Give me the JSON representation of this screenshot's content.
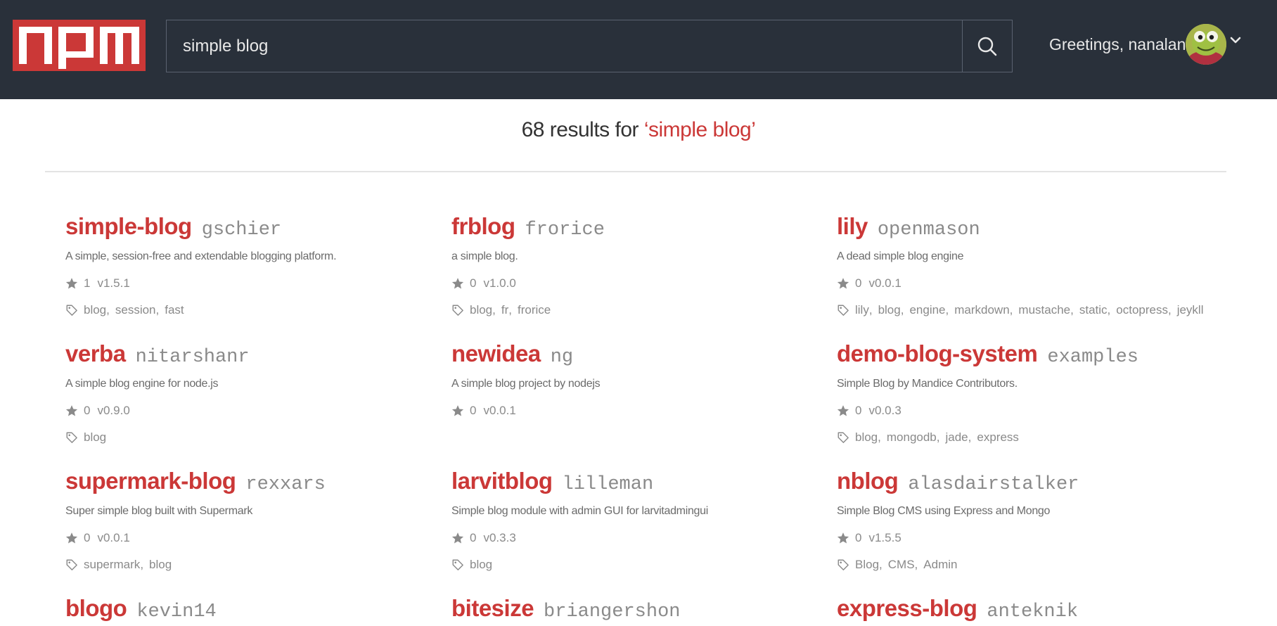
{
  "header": {
    "logo_text": "npm",
    "search_value": "simple blog",
    "search_icon": "search-icon",
    "greeting": "Greetings, nanalan",
    "avatar_icon": "avatar",
    "menu_icon": "chevron-down-icon"
  },
  "results": {
    "count": "68",
    "middle": " results for ",
    "query": "‘simple blog’"
  },
  "colors": {
    "header_bg": "#29303a",
    "brand_red": "#cb3837"
  },
  "packages": [
    {
      "name": "simple-blog",
      "author": "gschier",
      "description": "A simple, session-free and extendable blogging platform.",
      "stars": "1",
      "version": "v1.5.1",
      "tags": [
        "blog",
        "session",
        "fast"
      ]
    },
    {
      "name": "frblog",
      "author": "frorice",
      "description": "a simple blog.",
      "stars": "0",
      "version": "v1.0.0",
      "tags": [
        "blog",
        "fr",
        "frorice"
      ]
    },
    {
      "name": "lily",
      "author": "openmason",
      "description": "A dead simple blog engine",
      "stars": "0",
      "version": "v0.0.1",
      "tags": [
        "lily",
        "blog",
        "engine",
        "markdown",
        "mustache",
        "static",
        "octopress",
        "jeykll"
      ]
    },
    {
      "name": "verba",
      "author": "nitarshanr",
      "description": "A simple blog engine for node.js",
      "stars": "0",
      "version": "v0.9.0",
      "tags": [
        "blog"
      ]
    },
    {
      "name": "newidea",
      "author": "ng",
      "description": "A simple blog project by nodejs",
      "stars": "0",
      "version": "v0.0.1",
      "tags": []
    },
    {
      "name": "demo-blog-system",
      "author": "examples",
      "description": "Simple Blog by Mandice Contributors.",
      "stars": "0",
      "version": "v0.0.3",
      "tags": [
        "blog",
        "mongodb",
        "jade",
        "express"
      ]
    },
    {
      "name": "supermark-blog",
      "author": "rexxars",
      "description": "Super simple blog built with Supermark",
      "stars": "0",
      "version": "v0.0.1",
      "tags": [
        "supermark",
        "blog"
      ]
    },
    {
      "name": "larvitblog",
      "author": "lilleman",
      "description": "Simple blog module with admin GUI for larvitadmingui",
      "stars": "0",
      "version": "v0.3.3",
      "tags": [
        "blog"
      ]
    },
    {
      "name": "nblog",
      "author": "alasdairstalker",
      "description": "Simple Blog CMS using Express and Mongo",
      "stars": "0",
      "version": "v1.5.5",
      "tags": [
        "Blog",
        "CMS",
        "Admin"
      ]
    },
    {
      "name": "blogo",
      "author": "kevin14",
      "description": "",
      "stars": "",
      "version": "",
      "tags": []
    },
    {
      "name": "bitesize",
      "author": "briangershon",
      "description": "",
      "stars": "",
      "version": "",
      "tags": []
    },
    {
      "name": "express-blog",
      "author": "anteknik",
      "description": "",
      "stars": "",
      "version": "",
      "tags": []
    }
  ]
}
